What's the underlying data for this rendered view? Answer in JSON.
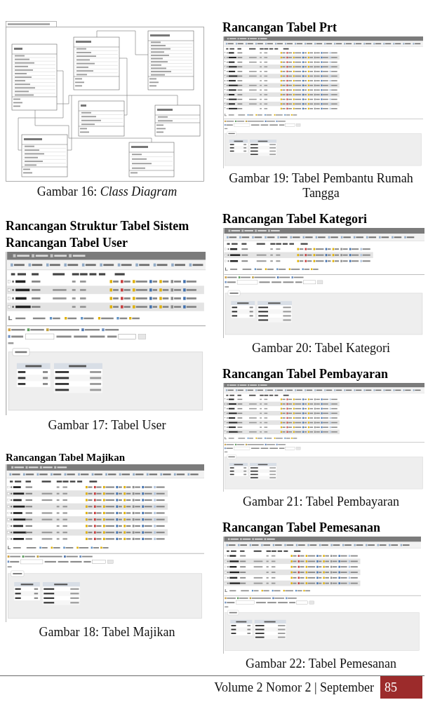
{
  "columns": [
    {
      "blocks": [
        {
          "kind": "diagram",
          "caption": "Gambar 16: *Class Diagram*"
        },
        {
          "kind": "heading",
          "text": "Rancangan Struktur Tabel Sistem"
        },
        {
          "kind": "heading",
          "text": "Rancangan Tabel User"
        },
        {
          "kind": "screenshot",
          "caption": "Gambar 17: Tabel User"
        },
        {
          "kind": "subheading",
          "text": "Rancangan Tabel Majikan"
        },
        {
          "kind": "screenshot",
          "caption": "Gambar 18: Tabel Majikan"
        }
      ]
    },
    {
      "blocks": [
        {
          "kind": "heading",
          "text": "Rancangan Tabel Prt"
        },
        {
          "kind": "screenshot",
          "caption": "Gambar 19: Tabel Pembantu Rumah Tangga"
        },
        {
          "kind": "heading",
          "text": "Rancangan Tabel Kategori"
        },
        {
          "kind": "screenshot",
          "caption": "Gambar 20: Tabel Kategori"
        },
        {
          "kind": "heading",
          "text": "Rancangan Tabel Pembayaran"
        },
        {
          "kind": "screenshot",
          "caption": "Gambar 21: Tabel Pembayaran"
        },
        {
          "kind": "heading",
          "text": "Rancangan Tabel Pemesanan"
        },
        {
          "kind": "screenshot",
          "caption": "Gambar 22: Tabel Pemesanan"
        }
      ]
    }
  ],
  "footer": {
    "issue": "Volume 2 Nomor 2 | September",
    "page_number": "85"
  }
}
